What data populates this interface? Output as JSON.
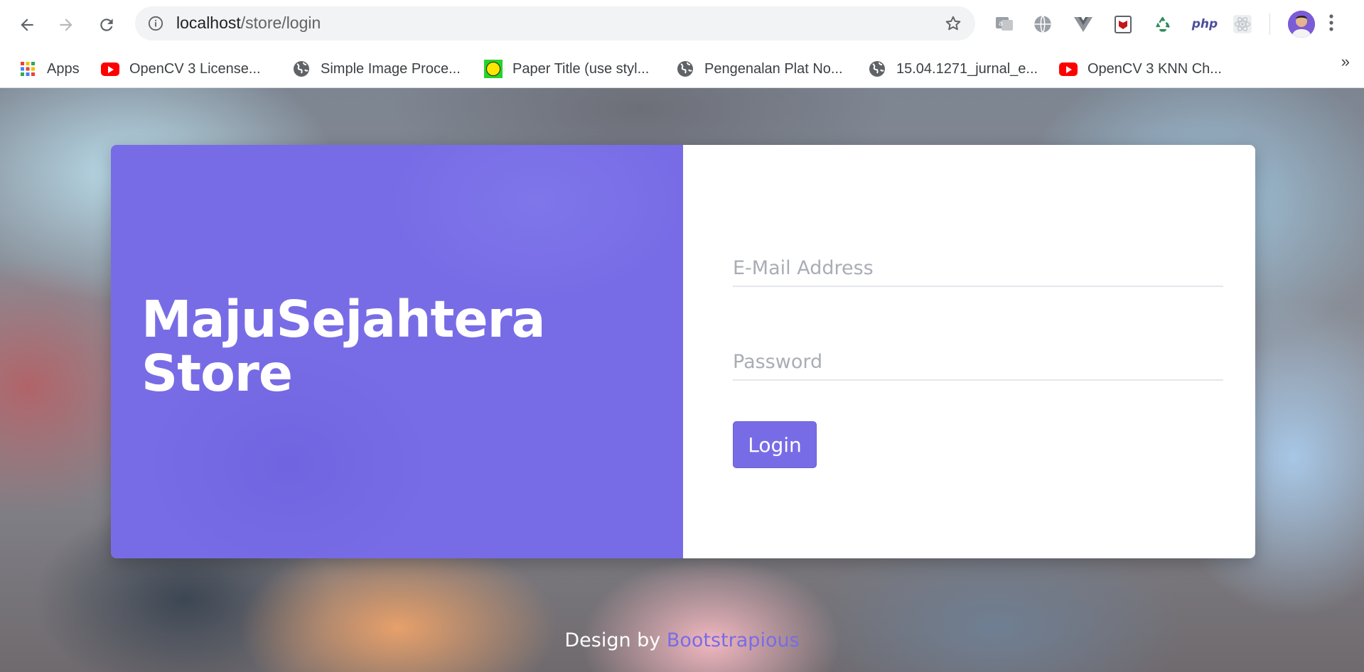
{
  "browser": {
    "url_host": "localhost",
    "url_path": "/store/login",
    "bookmarks": [
      {
        "label": "Apps",
        "icon": "apps-grid-icon"
      },
      {
        "label": "OpenCV 3 License...",
        "icon": "youtube-icon"
      },
      {
        "label": "Simple Image Proce...",
        "icon": "globe-icon"
      },
      {
        "label": "Paper Title (use styl...",
        "icon": "smiley-icon"
      },
      {
        "label": "Pengenalan Plat No...",
        "icon": "globe-icon"
      },
      {
        "label": "15.04.1271_jurnal_e...",
        "icon": "globe-icon"
      },
      {
        "label": "OpenCV 3 KNN Ch...",
        "icon": "youtube-icon"
      }
    ],
    "bookmarks_overflow": "»",
    "extensions": {
      "php_label": "php"
    }
  },
  "login": {
    "brand_line1": "MajuSejahtera",
    "brand_line2": "Store",
    "email_placeholder": "E-Mail Address",
    "password_placeholder": "Password",
    "login_label": "Login"
  },
  "footer": {
    "prefix": "Design by ",
    "link": "Bootstrapious"
  },
  "colors": {
    "accent": "#786ce6"
  }
}
